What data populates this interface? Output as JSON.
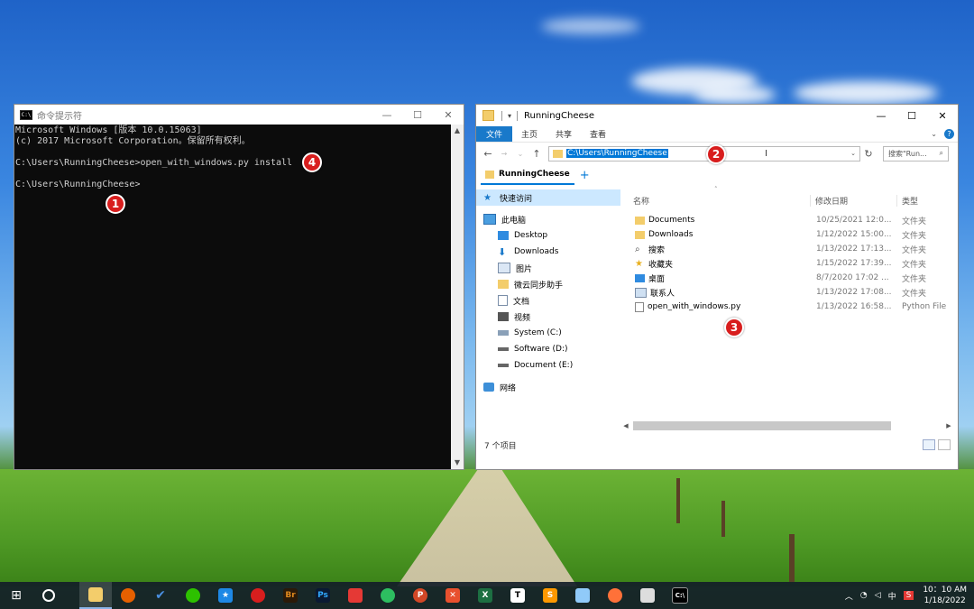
{
  "cmd": {
    "title": "命令提示符",
    "lines": [
      "Microsoft Windows [版本 10.0.15063]",
      "(c) 2017 Microsoft Corporation。保留所有权利。",
      "",
      "C:\\Users\\RunningCheese>open_with_windows.py install",
      "",
      "C:\\Users\\RunningCheese>"
    ],
    "minimize": "—",
    "maximize": "☐",
    "close": "✕"
  },
  "badges": {
    "b1": "1",
    "b2": "2",
    "b3": "3",
    "b4": "4"
  },
  "explorer": {
    "title": "RunningCheese",
    "ribbon": {
      "file": "文件",
      "home": "主页",
      "share": "共享",
      "view": "查看"
    },
    "address": "C:\\Users\\RunningCheese",
    "search_placeholder": "搜索\"Run...",
    "tab_label": "RunningCheese",
    "nav": {
      "quick_access": "快速访问",
      "this_pc": "此电脑",
      "items": [
        "Desktop",
        "Downloads",
        "图片",
        "微云同步助手",
        "文档",
        "视频",
        "System (C:)",
        "Software (D:)",
        "Document (E:)"
      ],
      "network": "网络"
    },
    "columns": {
      "name": "名称",
      "date": "修改日期",
      "type": "类型"
    },
    "files": [
      {
        "name": "Documents",
        "date": "10/25/2021 12:0...",
        "type": "文件夹",
        "icon": "folder"
      },
      {
        "name": "Downloads",
        "date": "1/12/2022 15:00...",
        "type": "文件夹",
        "icon": "folder"
      },
      {
        "name": "搜索",
        "date": "1/13/2022 17:13...",
        "type": "文件夹",
        "icon": "search"
      },
      {
        "name": "收藏夹",
        "date": "1/15/2022 17:39...",
        "type": "文件夹",
        "icon": "star"
      },
      {
        "name": "桌面",
        "date": "8/7/2020 17:02 ...",
        "type": "文件夹",
        "icon": "desktop"
      },
      {
        "name": "联系人",
        "date": "1/13/2022 17:08...",
        "type": "文件夹",
        "icon": "contacts"
      },
      {
        "name": "open_with_windows.py",
        "date": "1/13/2022 16:58...",
        "type": "Python File",
        "icon": "python"
      }
    ],
    "status": "7 个项目"
  },
  "taskbar": {
    "tray_lang": "中",
    "time": "10：10 AM",
    "date": "1/18/2022"
  },
  "colors": {
    "accent": "#0078d7",
    "ribbon_file": "#1979ca",
    "badge": "#d81e1e"
  }
}
